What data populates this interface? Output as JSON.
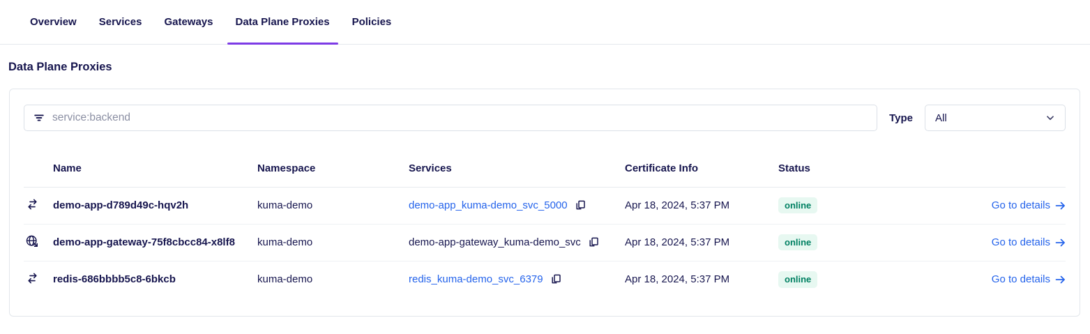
{
  "tabs": [
    {
      "label": "Overview",
      "active": false
    },
    {
      "label": "Services",
      "active": false
    },
    {
      "label": "Gateways",
      "active": false
    },
    {
      "label": "Data Plane Proxies",
      "active": true
    },
    {
      "label": "Policies",
      "active": false
    }
  ],
  "page_title": "Data Plane Proxies",
  "filter": {
    "search_placeholder": "service:backend",
    "type_label": "Type",
    "type_value": "All"
  },
  "table": {
    "columns": [
      "Name",
      "Namespace",
      "Services",
      "Certificate Info",
      "Status"
    ],
    "rows": [
      {
        "icon": "proxy-icon",
        "name": "demo-app-d789d49c-hqv2h",
        "namespace": "kuma-demo",
        "service": "demo-app_kuma-demo_svc_5000",
        "service_is_link": true,
        "certificate": "Apr 18, 2024, 5:37 PM",
        "status": "online",
        "details_label": "Go to details"
      },
      {
        "icon": "gateway-icon",
        "name": "demo-app-gateway-75f8cbcc84-x8lf8",
        "namespace": "kuma-demo",
        "service": "demo-app-gateway_kuma-demo_svc",
        "service_is_link": false,
        "certificate": "Apr 18, 2024, 5:37 PM",
        "status": "online",
        "details_label": "Go to details"
      },
      {
        "icon": "proxy-icon",
        "name": "redis-686bbbb5c8-6bkcb",
        "namespace": "kuma-demo",
        "service": "redis_kuma-demo_svc_6379",
        "service_is_link": true,
        "certificate": "Apr 18, 2024, 5:37 PM",
        "status": "online",
        "details_label": "Go to details"
      }
    ]
  },
  "colors": {
    "accent_purple": "#7d3be6",
    "link_blue": "#2463eb",
    "status_green": "#008062",
    "status_green_bg": "#e7f8f1",
    "text_navy": "#16154e"
  }
}
